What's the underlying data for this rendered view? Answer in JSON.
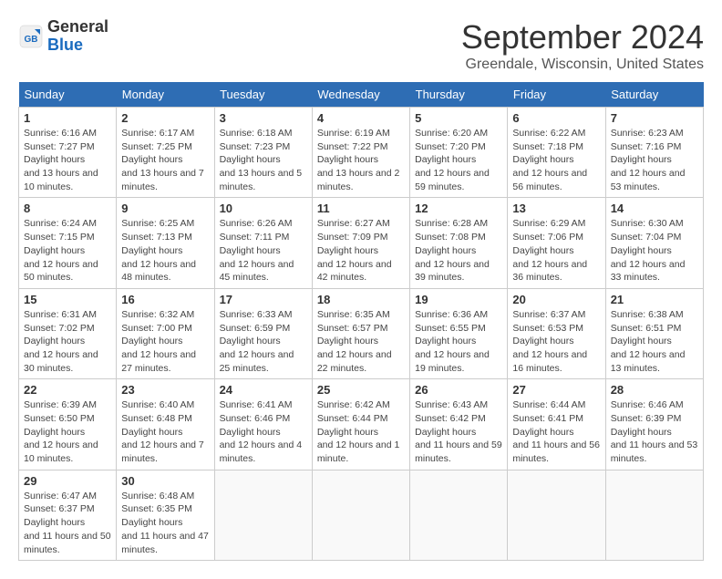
{
  "header": {
    "logo_general": "General",
    "logo_blue": "Blue",
    "month_year": "September 2024",
    "location": "Greendale, Wisconsin, United States"
  },
  "weekdays": [
    "Sunday",
    "Monday",
    "Tuesday",
    "Wednesday",
    "Thursday",
    "Friday",
    "Saturday"
  ],
  "weeks": [
    [
      {
        "day": "1",
        "sunrise": "6:16 AM",
        "sunset": "7:27 PM",
        "daylight": "13 hours and 10 minutes."
      },
      {
        "day": "2",
        "sunrise": "6:17 AM",
        "sunset": "7:25 PM",
        "daylight": "13 hours and 7 minutes."
      },
      {
        "day": "3",
        "sunrise": "6:18 AM",
        "sunset": "7:23 PM",
        "daylight": "13 hours and 5 minutes."
      },
      {
        "day": "4",
        "sunrise": "6:19 AM",
        "sunset": "7:22 PM",
        "daylight": "13 hours and 2 minutes."
      },
      {
        "day": "5",
        "sunrise": "6:20 AM",
        "sunset": "7:20 PM",
        "daylight": "12 hours and 59 minutes."
      },
      {
        "day": "6",
        "sunrise": "6:22 AM",
        "sunset": "7:18 PM",
        "daylight": "12 hours and 56 minutes."
      },
      {
        "day": "7",
        "sunrise": "6:23 AM",
        "sunset": "7:16 PM",
        "daylight": "12 hours and 53 minutes."
      }
    ],
    [
      {
        "day": "8",
        "sunrise": "6:24 AM",
        "sunset": "7:15 PM",
        "daylight": "12 hours and 50 minutes."
      },
      {
        "day": "9",
        "sunrise": "6:25 AM",
        "sunset": "7:13 PM",
        "daylight": "12 hours and 48 minutes."
      },
      {
        "day": "10",
        "sunrise": "6:26 AM",
        "sunset": "7:11 PM",
        "daylight": "12 hours and 45 minutes."
      },
      {
        "day": "11",
        "sunrise": "6:27 AM",
        "sunset": "7:09 PM",
        "daylight": "12 hours and 42 minutes."
      },
      {
        "day": "12",
        "sunrise": "6:28 AM",
        "sunset": "7:08 PM",
        "daylight": "12 hours and 39 minutes."
      },
      {
        "day": "13",
        "sunrise": "6:29 AM",
        "sunset": "7:06 PM",
        "daylight": "12 hours and 36 minutes."
      },
      {
        "day": "14",
        "sunrise": "6:30 AM",
        "sunset": "7:04 PM",
        "daylight": "12 hours and 33 minutes."
      }
    ],
    [
      {
        "day": "15",
        "sunrise": "6:31 AM",
        "sunset": "7:02 PM",
        "daylight": "12 hours and 30 minutes."
      },
      {
        "day": "16",
        "sunrise": "6:32 AM",
        "sunset": "7:00 PM",
        "daylight": "12 hours and 27 minutes."
      },
      {
        "day": "17",
        "sunrise": "6:33 AM",
        "sunset": "6:59 PM",
        "daylight": "12 hours and 25 minutes."
      },
      {
        "day": "18",
        "sunrise": "6:35 AM",
        "sunset": "6:57 PM",
        "daylight": "12 hours and 22 minutes."
      },
      {
        "day": "19",
        "sunrise": "6:36 AM",
        "sunset": "6:55 PM",
        "daylight": "12 hours and 19 minutes."
      },
      {
        "day": "20",
        "sunrise": "6:37 AM",
        "sunset": "6:53 PM",
        "daylight": "12 hours and 16 minutes."
      },
      {
        "day": "21",
        "sunrise": "6:38 AM",
        "sunset": "6:51 PM",
        "daylight": "12 hours and 13 minutes."
      }
    ],
    [
      {
        "day": "22",
        "sunrise": "6:39 AM",
        "sunset": "6:50 PM",
        "daylight": "12 hours and 10 minutes."
      },
      {
        "day": "23",
        "sunrise": "6:40 AM",
        "sunset": "6:48 PM",
        "daylight": "12 hours and 7 minutes."
      },
      {
        "day": "24",
        "sunrise": "6:41 AM",
        "sunset": "6:46 PM",
        "daylight": "12 hours and 4 minutes."
      },
      {
        "day": "25",
        "sunrise": "6:42 AM",
        "sunset": "6:44 PM",
        "daylight": "12 hours and 1 minute."
      },
      {
        "day": "26",
        "sunrise": "6:43 AM",
        "sunset": "6:42 PM",
        "daylight": "11 hours and 59 minutes."
      },
      {
        "day": "27",
        "sunrise": "6:44 AM",
        "sunset": "6:41 PM",
        "daylight": "11 hours and 56 minutes."
      },
      {
        "day": "28",
        "sunrise": "6:46 AM",
        "sunset": "6:39 PM",
        "daylight": "11 hours and 53 minutes."
      }
    ],
    [
      {
        "day": "29",
        "sunrise": "6:47 AM",
        "sunset": "6:37 PM",
        "daylight": "11 hours and 50 minutes."
      },
      {
        "day": "30",
        "sunrise": "6:48 AM",
        "sunset": "6:35 PM",
        "daylight": "11 hours and 47 minutes."
      },
      null,
      null,
      null,
      null,
      null
    ]
  ],
  "labels": {
    "sunrise": "Sunrise:",
    "sunset": "Sunset:",
    "daylight": "Daylight hours"
  }
}
